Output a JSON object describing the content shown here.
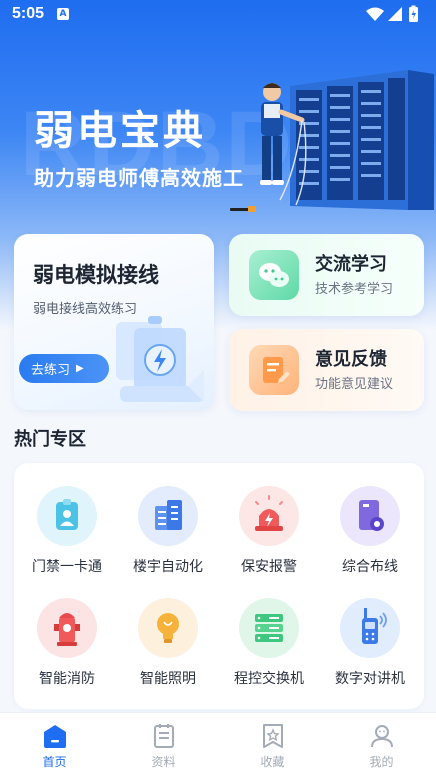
{
  "status_bar": {
    "time": "5:05",
    "notification_letter": "A"
  },
  "hero": {
    "title": "弱电宝典",
    "subtitle": "助力弱电师傅高效施工",
    "watermark": "RDBD"
  },
  "cards": {
    "practice": {
      "title": "弱电模拟接线",
      "subtitle": "弱电接线高效练习",
      "button_label": "去练习"
    },
    "exchange": {
      "title": "交流学习",
      "subtitle": "技术参考学习",
      "icon": "wechat-chat-icon"
    },
    "feedback": {
      "title": "意见反馈",
      "subtitle": "功能意见建议",
      "icon": "feedback-note-icon"
    }
  },
  "hot_section": {
    "title": "热门专区",
    "items": [
      {
        "label": "门禁一卡通",
        "icon": "access-card-icon"
      },
      {
        "label": "楼宇自动化",
        "icon": "building-icon"
      },
      {
        "label": "保安报警",
        "icon": "alarm-light-icon"
      },
      {
        "label": "综合布线",
        "icon": "cabling-icon"
      },
      {
        "label": "智能消防",
        "icon": "fire-hydrant-icon"
      },
      {
        "label": "智能照明",
        "icon": "light-bulb-icon"
      },
      {
        "label": "程控交换机",
        "icon": "switch-server-icon"
      },
      {
        "label": "数字对讲机",
        "icon": "walkie-talkie-icon"
      }
    ]
  },
  "tabbar": {
    "items": [
      {
        "label": "首页",
        "active": true,
        "icon": "home-icon"
      },
      {
        "label": "资料",
        "active": false,
        "icon": "document-icon"
      },
      {
        "label": "收藏",
        "active": false,
        "icon": "favorite-icon"
      },
      {
        "label": "我的",
        "active": false,
        "icon": "profile-icon"
      }
    ]
  },
  "colors": {
    "primary": "#1f6df0",
    "inactive_tab": "#a4abb8",
    "background": "#f4f7fc"
  }
}
